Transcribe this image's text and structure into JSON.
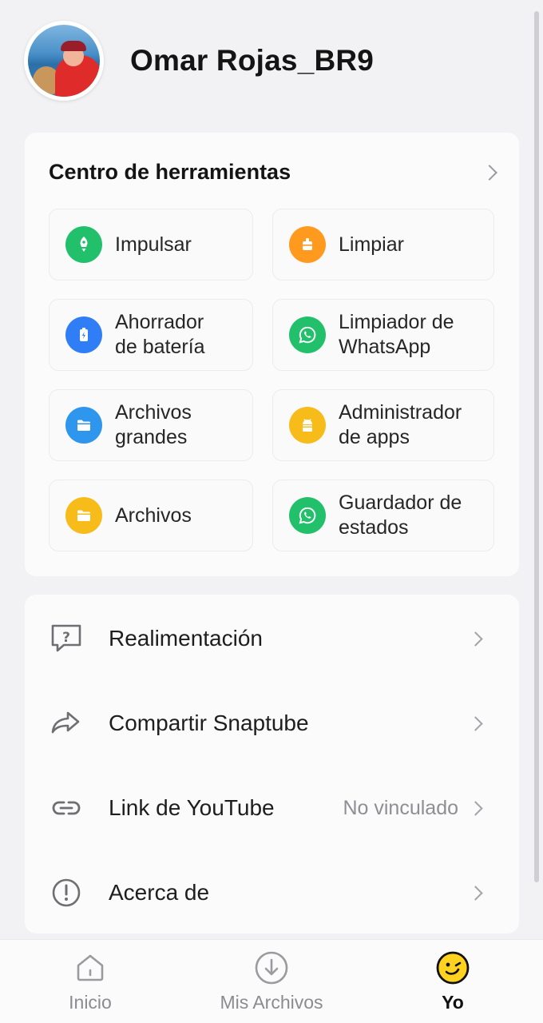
{
  "profile": {
    "name": "Omar Rojas_BR9",
    "avatar_icon": "avatar-photo"
  },
  "tools": {
    "title": "Centro de herramientas",
    "items": [
      {
        "label": "Impulsar",
        "icon": "rocket-icon",
        "color": "#22c06b"
      },
      {
        "label": "Limpiar",
        "icon": "broom-icon",
        "color": "#ff9a1f"
      },
      {
        "label": "Ahorrador\nde batería",
        "icon": "battery-icon",
        "color": "#2f7ef5"
      },
      {
        "label": "Limpiador de\nWhatsApp",
        "icon": "whatsapp-icon",
        "color": "#22c06b"
      },
      {
        "label": "Archivos\ngrandes",
        "icon": "folder-icon",
        "color": "#2f96ee"
      },
      {
        "label": "Administrador\nde apps",
        "icon": "android-icon",
        "color": "#f7bb1a"
      },
      {
        "label": "Archivos",
        "icon": "folder-icon",
        "color": "#f7bb1a"
      },
      {
        "label": "Guardador de\nestados",
        "icon": "whatsapp-icon",
        "color": "#22c06b"
      }
    ]
  },
  "settings": {
    "items": [
      {
        "label": "Realimentación",
        "icon": "feedback-icon",
        "value": ""
      },
      {
        "label": "Compartir Snaptube",
        "icon": "share-icon",
        "value": ""
      },
      {
        "label": "Link de YouTube",
        "icon": "link-icon",
        "value": "No vinculado"
      },
      {
        "label": "Acerca de",
        "icon": "info-icon",
        "value": ""
      }
    ]
  },
  "nav": {
    "items": [
      {
        "label": "Inicio",
        "icon": "home-icon",
        "active": false
      },
      {
        "label": "Mis Archivos",
        "icon": "download-icon",
        "active": false
      },
      {
        "label": "Yo",
        "icon": "smiley-icon",
        "active": true
      }
    ]
  },
  "colors": {
    "background": "#f2f2f4",
    "card": "#fbfbfc",
    "secondary_text": "#8e8e93"
  }
}
